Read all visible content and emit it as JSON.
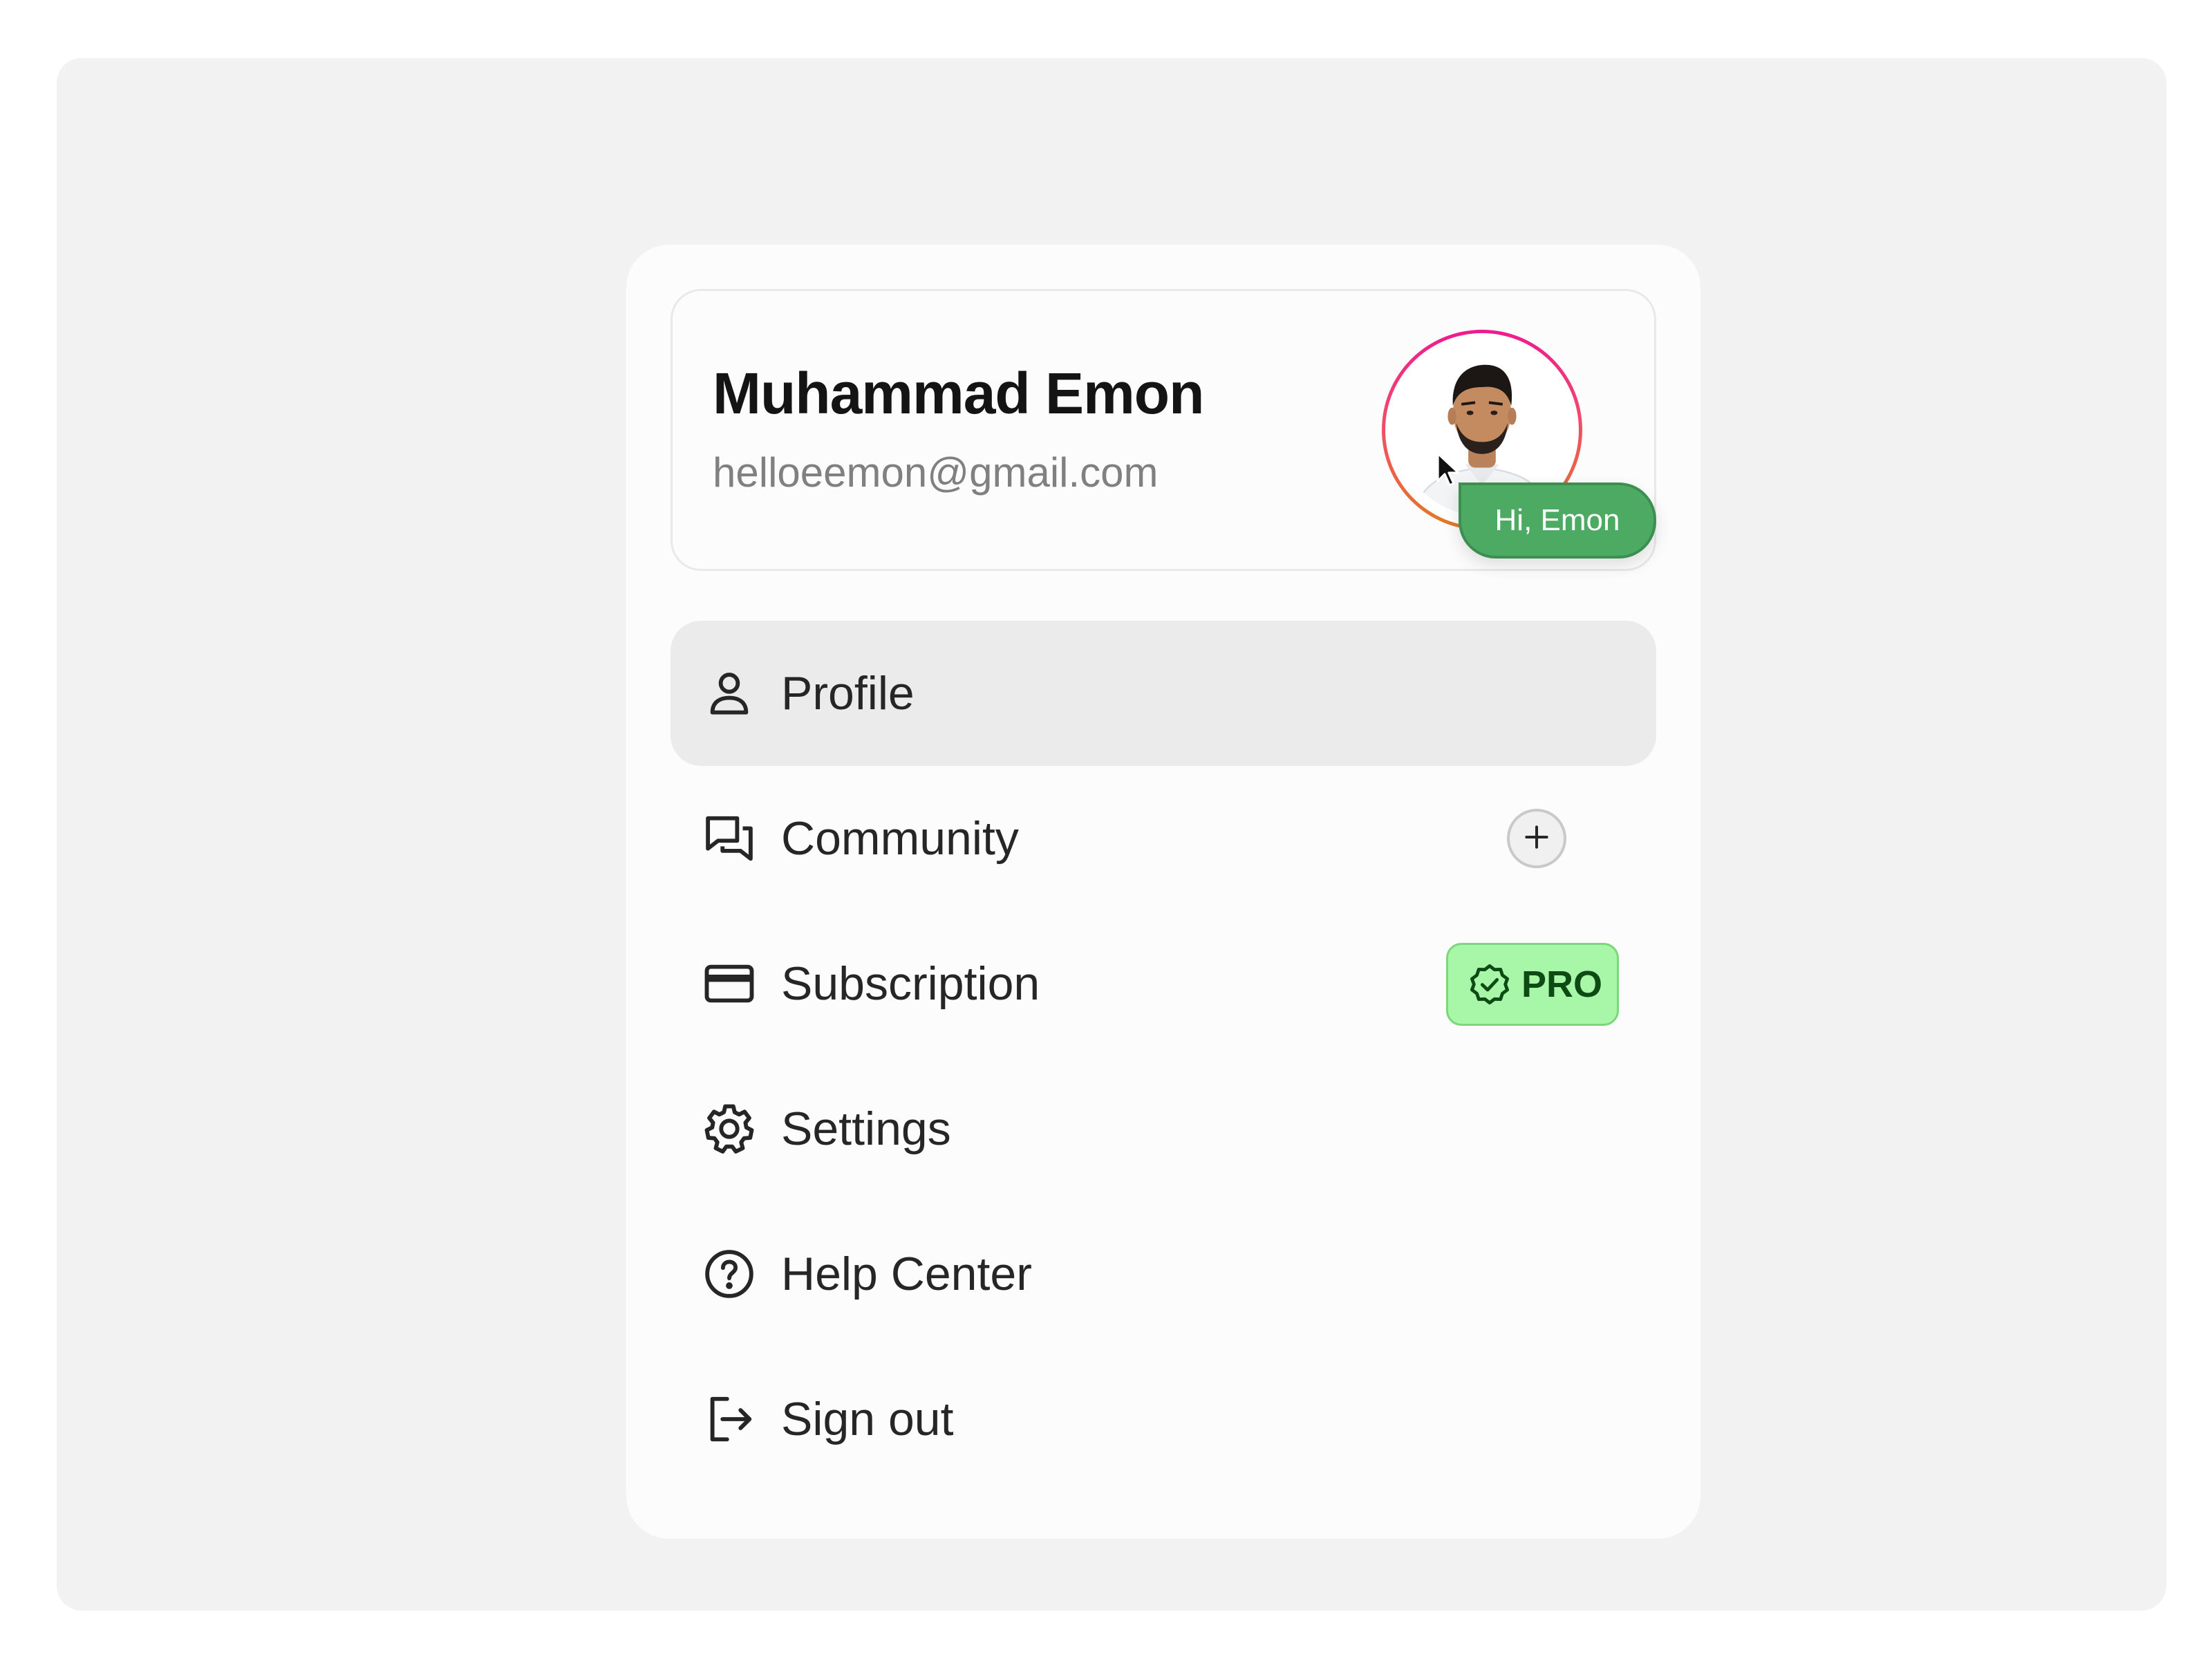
{
  "user": {
    "name": "Muhammad Emon",
    "email": "helloeemon@gmail.com",
    "avatar_icon": "profile-photo",
    "ring_colors": [
      "#ee1b8f",
      "#e37a22"
    ]
  },
  "tooltip": {
    "text": "Hi, Emon",
    "color": "#4caa62"
  },
  "menu": {
    "items": [
      {
        "label": "Profile",
        "icon": "user-icon",
        "active": true
      },
      {
        "label": "Community",
        "icon": "chat-bubbles-icon",
        "action_icon": "plus-icon"
      },
      {
        "label": "Subscription",
        "icon": "credit-card-icon",
        "badge": "PRO",
        "badge_icon": "verified-badge-icon"
      },
      {
        "label": "Settings",
        "icon": "gear-icon"
      },
      {
        "label": "Help Center",
        "icon": "question-circle-icon"
      },
      {
        "label": "Sign out",
        "icon": "sign-out-icon"
      }
    ]
  },
  "colors": {
    "background": "#f2f2f2",
    "card": "#fcfcfc",
    "active_item": "#ebebeb",
    "pro_badge_bg": "#a8f7a8",
    "pro_badge_text": "#0d4a14"
  }
}
